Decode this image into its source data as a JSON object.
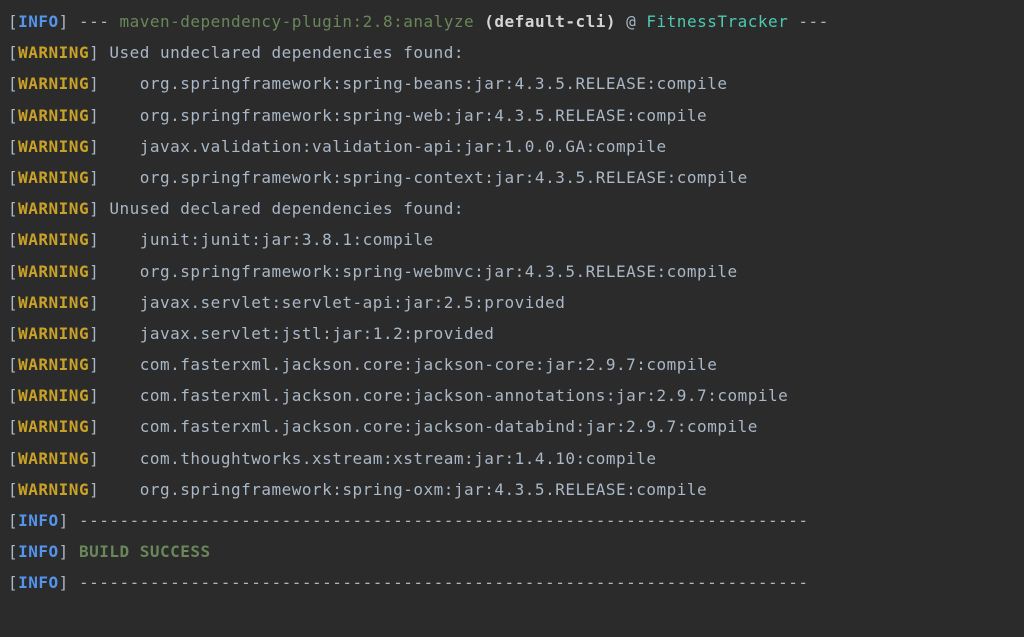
{
  "log": {
    "levels": {
      "info": "INFO",
      "warning": "WARNING"
    },
    "header": {
      "dash3": "---",
      "plugin": "maven-dependency-plugin:2.8:analyze",
      "goal": "(default-cli)",
      "at": "@",
      "project": "FitnessTracker",
      "trailing": "---"
    },
    "sections": {
      "used_undeclared": {
        "title": "Used undeclared dependencies found:",
        "deps": [
          "org.springframework:spring-beans:jar:4.3.5.RELEASE:compile",
          "org.springframework:spring-web:jar:4.3.5.RELEASE:compile",
          "javax.validation:validation-api:jar:1.0.0.GA:compile",
          "org.springframework:spring-context:jar:4.3.5.RELEASE:compile"
        ]
      },
      "unused_declared": {
        "title": "Unused declared dependencies found:",
        "deps": [
          "junit:junit:jar:3.8.1:compile",
          "org.springframework:spring-webmvc:jar:4.3.5.RELEASE:compile",
          "javax.servlet:servlet-api:jar:2.5:provided",
          "javax.servlet:jstl:jar:1.2:provided",
          "com.fasterxml.jackson.core:jackson-core:jar:2.9.7:compile",
          "com.fasterxml.jackson.core:jackson-annotations:jar:2.9.7:compile",
          "com.fasterxml.jackson.core:jackson-databind:jar:2.9.7:compile",
          "com.thoughtworks.xstream:xstream:jar:1.4.10:compile",
          "org.springframework:spring-oxm:jar:4.3.5.RELEASE:compile"
        ]
      }
    },
    "separator": "------------------------------------------------------------------------",
    "build_status": "BUILD SUCCESS"
  }
}
